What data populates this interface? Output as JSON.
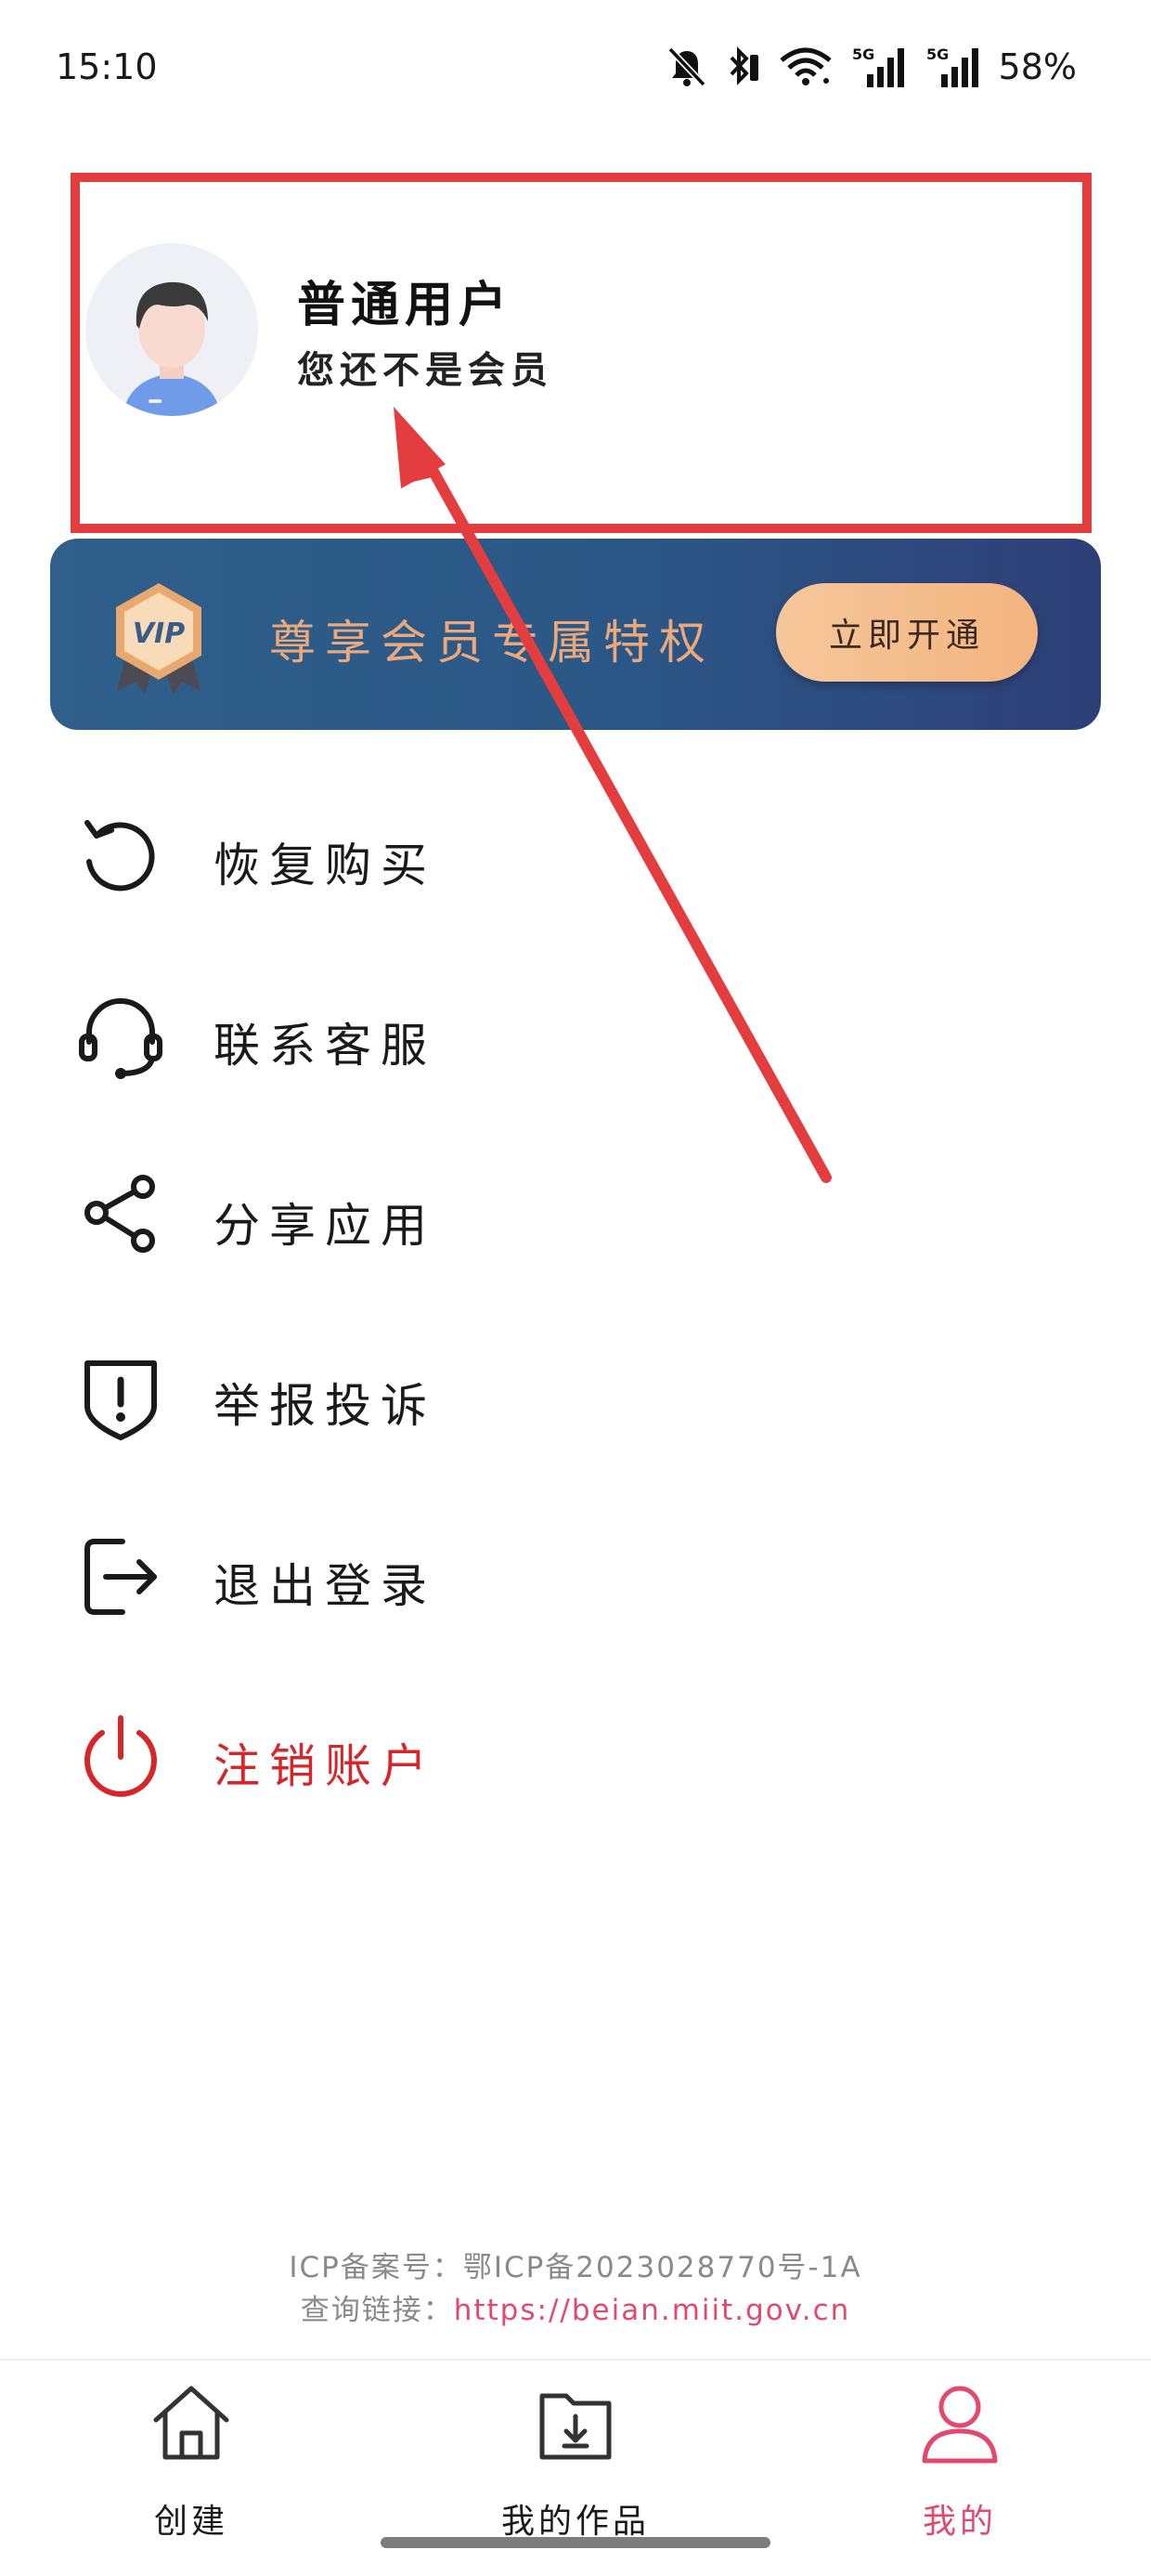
{
  "status_bar": {
    "time": "15:10",
    "battery": "58%",
    "network_badge_1": "5G",
    "network_badge_2": "5G",
    "icons": [
      "bell-off-icon",
      "bluetooth-icon",
      "wifi-icon",
      "signal-5g-icon",
      "signal-5g-icon"
    ]
  },
  "profile": {
    "name": "普通用户",
    "status": "您还不是会员"
  },
  "vip_banner": {
    "badge_text": "VIP",
    "title": "尊享会员专属特权",
    "button_label": "立即开通"
  },
  "menu": {
    "items": [
      {
        "label": "恢复购买",
        "icon": "restore-icon"
      },
      {
        "label": "联系客服",
        "icon": "headset-icon"
      },
      {
        "label": "分享应用",
        "icon": "share-icon"
      },
      {
        "label": "举报投诉",
        "icon": "report-shield-icon"
      },
      {
        "label": "退出登录",
        "icon": "logout-icon"
      },
      {
        "label": "注销账户",
        "icon": "power-icon"
      }
    ]
  },
  "footer": {
    "icp_label": "ICP备案号：鄂ICP备2023028770号-1A",
    "query_label": "查询链接：",
    "query_link": "https://beian.miit.gov.cn"
  },
  "bottom_nav": {
    "items": [
      {
        "label": "创建",
        "icon": "home-icon",
        "active": false
      },
      {
        "label": "我的作品",
        "icon": "folder-download-icon",
        "active": false
      },
      {
        "label": "我的",
        "icon": "user-icon",
        "active": true
      }
    ]
  },
  "colors": {
    "accent": "#e2496f",
    "danger": "#d6262a",
    "annotation": "#e43d3f",
    "vip_gold": "#eaa87c",
    "vip_bg": "#2c5787"
  }
}
